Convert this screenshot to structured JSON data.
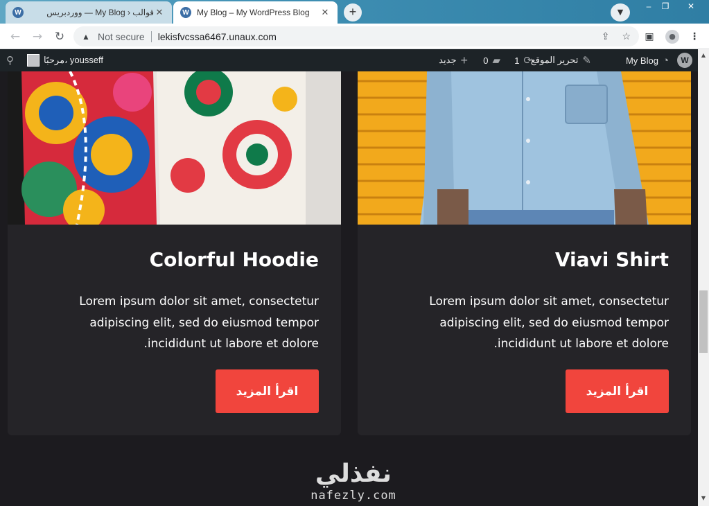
{
  "browser": {
    "tabs": [
      {
        "title": "قوالب ‹ My Blog — ووردبريس",
        "active": false
      },
      {
        "title": "My Blog – My WordPress Blog",
        "active": true
      }
    ],
    "new_tab": "+",
    "security_label": "Not secure",
    "url": "lekisfvcssa6467.unaux.com",
    "window_controls": {
      "minimize": "–",
      "maximize": "❐",
      "close": "✕"
    }
  },
  "adminbar": {
    "site_name": "My Blog",
    "customize": "تحرير الموقع",
    "updates_count": "1",
    "comments_count": "0",
    "new_label": "جديد",
    "greeting": "مرحبًا، yousseff"
  },
  "cards": [
    {
      "title": "Colorful Hoodie",
      "text_lines": [
        "Lorem ipsum dolor sit amet, consectetur",
        "adipiscing elit, sed do eiusmod tempor",
        "incididunt ut labore et dolore."
      ],
      "button": "اقرأ المزيد"
    },
    {
      "title": "Viavi Shirt",
      "text_lines": [
        "Lorem ipsum dolor sit amet, consectetur",
        "adipiscing elit, sed do eiusmod tempor",
        "incididunt ut labore et dolore."
      ],
      "button": "اقرأ المزيد"
    }
  ],
  "watermark": {
    "arabic": "نفذلي",
    "latin": "nafezly.com"
  },
  "icons": {
    "tab_favicon": "wordpress-icon",
    "wp_logo": "wordpress-logo-icon",
    "customize": "brush-icon",
    "updates": "refresh-icon",
    "comments": "comment-bubble-icon",
    "new": "plus-icon",
    "search": "search-icon"
  },
  "colors": {
    "page_bg": "#1c1b1f",
    "card_bg": "#252428",
    "button_bg": "#f1453d",
    "adminbar_bg": "#1d2327"
  }
}
